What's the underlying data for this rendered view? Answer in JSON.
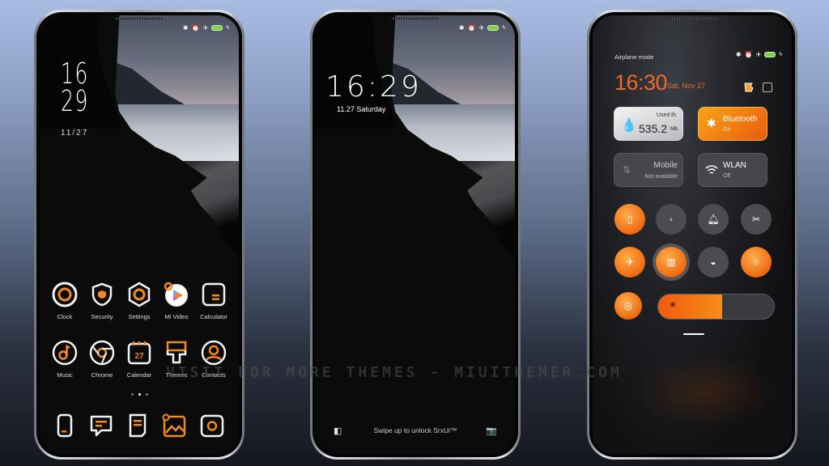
{
  "status_bar": {
    "icons": [
      "bluetooth-icon",
      "alarm-icon",
      "airplane-icon",
      "battery-icon",
      "charging-icon"
    ],
    "bluetooth": "✱",
    "alarm": "⏰",
    "airplane": "✈",
    "charging": "ϟ",
    "battery_color": "#7cd34a"
  },
  "home": {
    "clock_hour": "16",
    "clock_minute": "29",
    "date": "11/27",
    "apps_row1": [
      {
        "label": "Clock",
        "icon": "clock-icon"
      },
      {
        "label": "Security",
        "icon": "shield-icon"
      },
      {
        "label": "Settings",
        "icon": "gear-icon"
      },
      {
        "label": "Mi Video",
        "icon": "play-icon"
      },
      {
        "label": "Calculator",
        "icon": "calculator-icon"
      }
    ],
    "apps_row2": [
      {
        "label": "Music",
        "icon": "music-icon"
      },
      {
        "label": "Chrome",
        "icon": "chrome-icon"
      },
      {
        "label": "Calendar",
        "icon": "calendar-icon",
        "badge": "27"
      },
      {
        "label": "Themes",
        "icon": "paintbrush-icon"
      },
      {
        "label": "Contacts",
        "icon": "contact-icon"
      }
    ],
    "page_indicator": {
      "pages": 3,
      "current": 2
    },
    "dock": [
      "phone-icon",
      "messages-icon",
      "notes-icon",
      "gallery-icon",
      "camera-icon"
    ]
  },
  "lock": {
    "time": "16:29",
    "date": "11.27 Saturday",
    "swipe_text": "Swipe up to unlock SrxUi™"
  },
  "control_center": {
    "mode_label": "Airplane mode",
    "time": "16:30",
    "date": "Sat, Nov 27",
    "tiles": [
      {
        "name": "data-usage",
        "title": "Used th",
        "sub": "",
        "value": "535.2",
        "unit": "MB",
        "state": "light"
      },
      {
        "name": "bluetooth",
        "title": "Bluetooth",
        "sub": "On",
        "state": "on"
      },
      {
        "name": "mobile-data",
        "title": "Mobile",
        "sub": "Not available",
        "state": "off"
      },
      {
        "name": "wlan",
        "title": "WLAN",
        "sub": "Off",
        "state": "off"
      }
    ],
    "toggles": [
      {
        "name": "vibrate",
        "icon": "vibrate-icon",
        "glyph": "▯",
        "on": true
      },
      {
        "name": "flashlight",
        "icon": "flashlight-icon",
        "glyph": "♁",
        "on": false
      },
      {
        "name": "ring",
        "icon": "bell-icon",
        "glyph": "🔔",
        "on": false
      },
      {
        "name": "screenshot",
        "icon": "scissors-icon",
        "glyph": "✂",
        "on": false
      },
      {
        "name": "airplane",
        "icon": "airplane-icon",
        "glyph": "✈",
        "on": true
      },
      {
        "name": "reading-mode",
        "icon": "book-icon",
        "glyph": "▥",
        "on": true
      },
      {
        "name": "lock-screen",
        "icon": "lock-icon",
        "glyph": "◒",
        "on": false
      },
      {
        "name": "location",
        "icon": "location-pin-icon",
        "glyph": "⌾",
        "on": true
      },
      {
        "name": "auto-brightness",
        "icon": "target-icon",
        "glyph": "◎",
        "on": true
      }
    ],
    "brightness_percent": 55
  },
  "watermark": "VISIT FOR MORE THEMES - MIUITHEMER.COM",
  "colors": {
    "accent": "#ef6a2a",
    "icon_orange": "#f28a1c",
    "icon_white": "#f2f2f2"
  }
}
